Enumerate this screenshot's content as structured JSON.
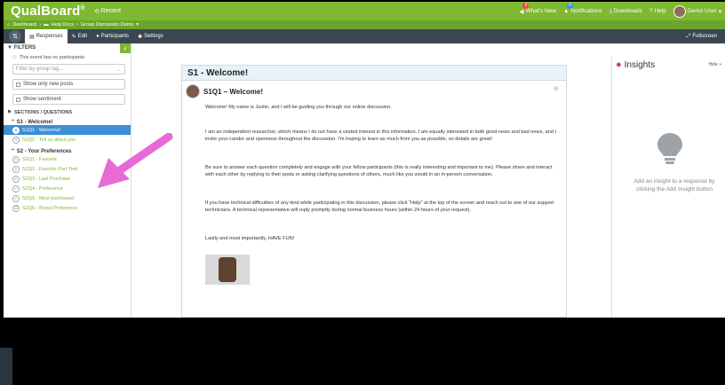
{
  "app": {
    "brand": "QualBoard",
    "reg": "®",
    "recent": "Recent"
  },
  "topnav": {
    "whats_new": "What's New",
    "whats_new_badge": "2",
    "notifications": "Notifications",
    "notifications_badge": "0",
    "downloads": "Downloads",
    "help": "Help",
    "user": "Demo User"
  },
  "breadcrumb": [
    "Dashboard",
    "Help Docs",
    "Group Discussion Demo"
  ],
  "tabs": [
    "Responses",
    "Edit",
    "Participants",
    "Settings"
  ],
  "fullscreen": "Fullscreen",
  "sidebar": {
    "filters": "FILTERS",
    "no_participants": "This event has no participants",
    "group_tag_placeholder": "Filter by group tag...",
    "show_new": "Show only new posts",
    "show_sentiment": "Show sentiment",
    "sections_header": "SECTIONS / QUESTIONS",
    "groups": [
      {
        "title": "S1 - Welcome!",
        "items": [
          "S1Q1 - Welcome!",
          "S1Q2 - Tell us about you"
        ]
      },
      {
        "title": "S2 - Your Preferences",
        "items": [
          "S2Q1 - Favorite",
          "S2Q2 - Favorite Part Tied",
          "S2Q3 - Last Purchase",
          "S2Q4 - Preference",
          "S2Q5 - Most purchased",
          "S2Q6 - Brand Preference"
        ]
      }
    ]
  },
  "main": {
    "section_title": "S1 - Welcome!",
    "post_title": "S1Q1 – Welcome!",
    "paragraphs": [
      "Welcome! My name is Justin, and I will be guiding you through our online discussion.",
      "I am an independent researcher, which means I do not have a vested interest in this information. I am equally interested in both good news and bad news, and I invite your candor and openness throughout the discussion. I'm hoping to learn as much from you as possible, so details are great!",
      "Be sure to answer each question completely and engage with your fellow participants (this is really interesting and important to me). Please share and interact with each other by replying to their posts or asking clarifying questions of others, much like you would in an in-person conversation.",
      "If you have technical difficulties of any kind while participating in this discussion, please click \"Help\" at the top of the screen and reach out to one of our support technicians. A technical representative will reply promptly during normal business hours (within 24 hours of your request).",
      "Lastly and most importantly, HAVE FUN!"
    ]
  },
  "insights": {
    "title": "Insights",
    "hide": "Hide",
    "message": "Add an insight to a response by clicking the Add Insight button"
  },
  "colors": {
    "brand_green": "#7fb832",
    "active_blue": "#3b8fd6",
    "arrow_pink": "#e86ad8"
  },
  "icons": [
    "clock-icon",
    "megaphone-icon",
    "bell-icon",
    "download-icon",
    "help-icon",
    "home-icon",
    "folder-icon",
    "filter-icon",
    "eye-slash-icon",
    "lightbulb-icon"
  ]
}
